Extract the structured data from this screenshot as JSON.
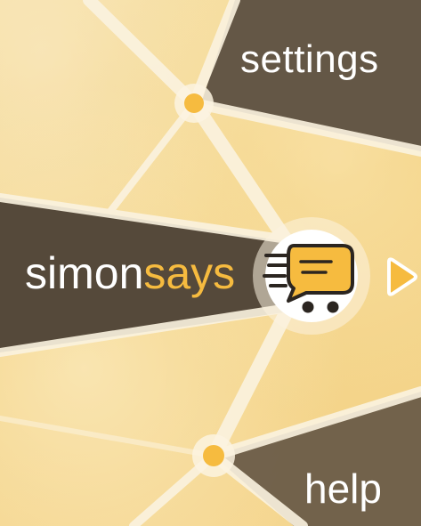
{
  "menu": {
    "settings_label": "settings",
    "help_label": "help"
  },
  "brand": {
    "part1": "simon",
    "part2": "says",
    "accent_color": "#f6bb3f",
    "panel_color": "#5b4f3f"
  },
  "icons": {
    "logo": "chat-cart-icon",
    "next": "play-arrow-icon"
  }
}
